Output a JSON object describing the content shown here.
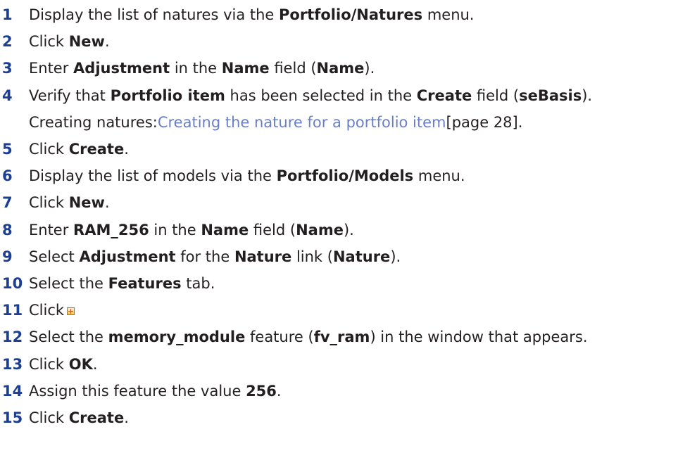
{
  "steps": [
    {
      "num": "1",
      "parts": [
        {
          "t": "Display the list of natures via the "
        },
        {
          "t": "Portfolio/Natures",
          "b": true
        },
        {
          "t": " menu."
        }
      ]
    },
    {
      "num": "2",
      "parts": [
        {
          "t": "Click "
        },
        {
          "t": "New",
          "b": true
        },
        {
          "t": "."
        }
      ]
    },
    {
      "num": "3",
      "parts": [
        {
          "t": "Enter "
        },
        {
          "t": "Adjustment",
          "b": true
        },
        {
          "t": " in the "
        },
        {
          "t": "Name",
          "b": true
        },
        {
          "t": " field ("
        },
        {
          "t": "Name",
          "b": true
        },
        {
          "t": ")."
        }
      ]
    },
    {
      "num": "4",
      "parts": [
        {
          "t": "Verify that "
        },
        {
          "t": "Portfolio item",
          "b": true
        },
        {
          "t": " has been selected in the "
        },
        {
          "t": "Create",
          "b": true
        },
        {
          "t": " field ("
        },
        {
          "t": "seBasis",
          "b": true
        },
        {
          "t": ")."
        }
      ],
      "sub": {
        "prefix": "Creating natures: ",
        "link": "Creating the nature for a portfolio item",
        "suffix": " [page 28]."
      }
    },
    {
      "num": "5",
      "parts": [
        {
          "t": "Click "
        },
        {
          "t": "Create",
          "b": true
        },
        {
          "t": "."
        }
      ]
    },
    {
      "num": "6",
      "parts": [
        {
          "t": "Display the list of models via the "
        },
        {
          "t": "Portfolio/Models",
          "b": true
        },
        {
          "t": " menu."
        }
      ]
    },
    {
      "num": "7",
      "parts": [
        {
          "t": "Click "
        },
        {
          "t": "New",
          "b": true
        },
        {
          "t": "."
        }
      ]
    },
    {
      "num": "8",
      "parts": [
        {
          "t": "Enter "
        },
        {
          "t": "RAM_256",
          "b": true
        },
        {
          "t": " in the "
        },
        {
          "t": "Name",
          "b": true
        },
        {
          "t": " field ("
        },
        {
          "t": "Name",
          "b": true
        },
        {
          "t": ")."
        }
      ]
    },
    {
      "num": "9",
      "parts": [
        {
          "t": "Select "
        },
        {
          "t": "Adjustment",
          "b": true
        },
        {
          "t": " for the "
        },
        {
          "t": "Nature",
          "b": true
        },
        {
          "t": " link ("
        },
        {
          "t": "Nature",
          "b": true
        },
        {
          "t": ")."
        }
      ]
    },
    {
      "num": "10",
      "parts": [
        {
          "t": "Select the "
        },
        {
          "t": "Features",
          "b": true
        },
        {
          "t": " tab."
        }
      ]
    },
    {
      "num": "11",
      "parts": [
        {
          "t": "Click"
        }
      ],
      "icon": "add-icon"
    },
    {
      "num": "12",
      "parts": [
        {
          "t": "Select the "
        },
        {
          "t": "memory_module",
          "b": true
        },
        {
          "t": " feature ("
        },
        {
          "t": "fv_ram",
          "b": true
        },
        {
          "t": ") in the window that appears."
        }
      ]
    },
    {
      "num": "13",
      "parts": [
        {
          "t": "Click "
        },
        {
          "t": "OK",
          "b": true
        },
        {
          "t": "."
        }
      ]
    },
    {
      "num": "14",
      "parts": [
        {
          "t": "Assign this feature the value "
        },
        {
          "t": "256",
          "b": true
        },
        {
          "t": "."
        }
      ]
    },
    {
      "num": "15",
      "parts": [
        {
          "t": "Click "
        },
        {
          "t": "Create",
          "b": true
        },
        {
          "t": "."
        }
      ]
    }
  ],
  "colors": {
    "number": "#1c3f94",
    "link": "#6b7fc4",
    "text": "#231f20"
  }
}
